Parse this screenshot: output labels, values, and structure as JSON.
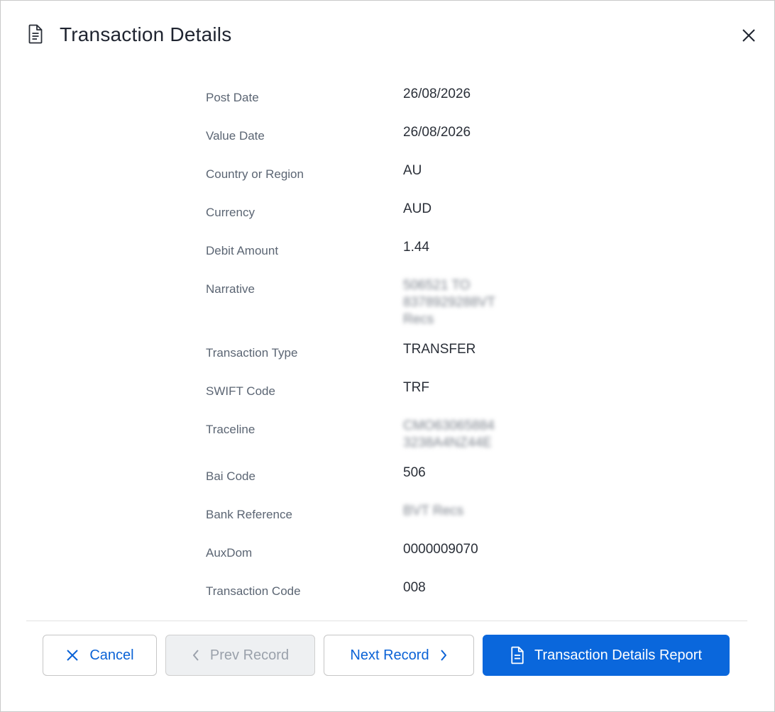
{
  "header": {
    "title": "Transaction Details",
    "icon": "document-icon",
    "close_icon": "close-icon"
  },
  "details": [
    {
      "label": "Post Date",
      "value": [
        "26/08/2026"
      ]
    },
    {
      "label": "Value Date",
      "value": [
        "26/08/2026"
      ]
    },
    {
      "label": "Country or Region",
      "value": [
        "AU"
      ]
    },
    {
      "label": "Currency",
      "value": [
        "AUD"
      ]
    },
    {
      "label": "Debit Amount",
      "value": [
        "1.44"
      ]
    },
    {
      "label": "Narrative",
      "value": [
        "506521 TO",
        "8378929288VT",
        "Recs"
      ],
      "blurred": true
    },
    {
      "label": "Transaction Type",
      "value": [
        "TRANSFER"
      ]
    },
    {
      "label": "SWIFT Code",
      "value": [
        "TRF"
      ]
    },
    {
      "label": "Traceline",
      "value": [
        "CMO63065884",
        "3238A4NZ44E"
      ],
      "blurred": true
    },
    {
      "label": "Bai Code",
      "value": [
        "506"
      ]
    },
    {
      "label": "Bank Reference",
      "value": [
        "BVT Recs"
      ],
      "blurred": true
    },
    {
      "label": "AuxDom",
      "value": [
        "0000009070"
      ]
    },
    {
      "label": "Transaction Code",
      "value": [
        "008"
      ]
    }
  ],
  "footer": {
    "cancel_label": "Cancel",
    "prev_label": "Prev Record",
    "next_label": "Next Record",
    "report_label": "Transaction Details Report"
  },
  "colors": {
    "accent": "#0a67dc",
    "disabled_bg": "#eef0f2",
    "label_text": "#5b6573"
  }
}
